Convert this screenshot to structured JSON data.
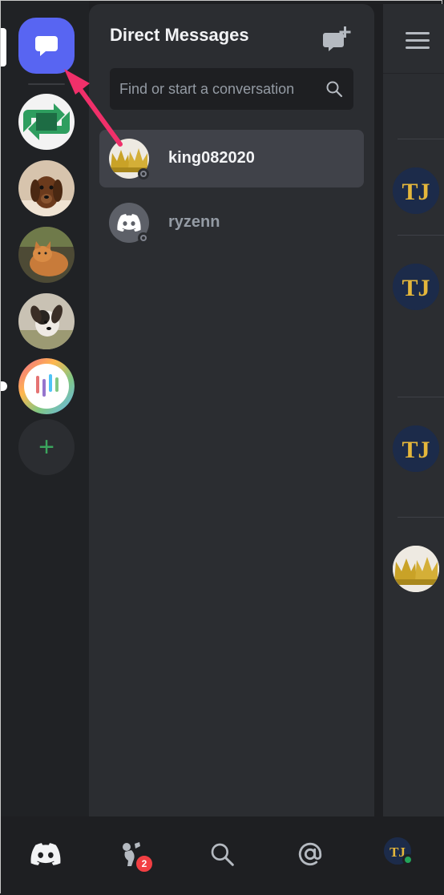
{
  "header": {
    "title": "Direct Messages"
  },
  "search": {
    "placeholder": "Find or start a conversation"
  },
  "dms": [
    {
      "name": "king082020",
      "status": "offline",
      "selected": true
    },
    {
      "name": "ryzenn",
      "status": "offline",
      "selected": false
    }
  ],
  "nav": {
    "items": [
      "home-icon",
      "friends-icon",
      "search-icon",
      "mentions-icon",
      "profile-avatar"
    ],
    "friends_badge": "2"
  },
  "colors": {
    "blurple": "#5865f2",
    "annotation_arrow": "#f0306a",
    "online": "#23a55a",
    "badge": "#f23f43"
  }
}
